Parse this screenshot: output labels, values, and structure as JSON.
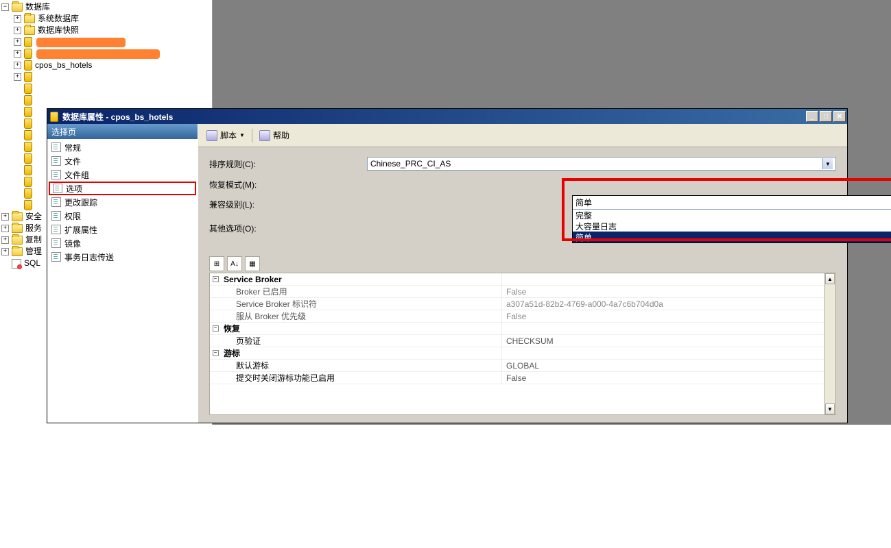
{
  "tree": {
    "root": "数据库",
    "system_db": "系统数据库",
    "snapshot": "数据库快照",
    "cpos": "cpos_bs_hotels",
    "security": "安全",
    "server": "服务",
    "replication": "复制",
    "management": "管理",
    "sql": "SQL"
  },
  "dialog": {
    "title": "数据库属性 - cpos_bs_hotels",
    "sidebar_header": "选择页",
    "pages": {
      "general": "常规",
      "files": "文件",
      "filegroups": "文件组",
      "options": "选项",
      "change_tracking": "更改跟踪",
      "permissions": "权限",
      "extended": "扩展属性",
      "mirroring": "镜像",
      "log_shipping": "事务日志传送"
    },
    "toolbar": {
      "script": "脚本",
      "help": "帮助"
    },
    "form": {
      "collation_label": "排序规则(C):",
      "collation_value": "Chinese_PRC_CI_AS",
      "recovery_label": "恢复模式(M):",
      "recovery_value": "简单",
      "compat_label": "兼容级别(L):",
      "other_label": "其他选项(O):"
    },
    "dropdown": {
      "opt1": "完整",
      "opt2": "大容量日志",
      "opt3": "简单"
    },
    "grid": {
      "cat_broker": "Service Broker",
      "broker_enabled": "Broker 已启用",
      "broker_enabled_val": "False",
      "broker_id": "Service Broker 标识符",
      "broker_id_val": "a307a51d-82b2-4769-a000-4a7c6b704d0a",
      "broker_priority": "服从 Broker 优先级",
      "broker_priority_val": "False",
      "cat_recovery": "恢复",
      "page_verify": "页验证",
      "page_verify_val": "CHECKSUM",
      "cat_cursor": "游标",
      "default_cursor": "默认游标",
      "default_cursor_val": "GLOBAL",
      "commit_cursor": "提交时关闭游标功能已启用",
      "commit_cursor_val": "False"
    }
  }
}
